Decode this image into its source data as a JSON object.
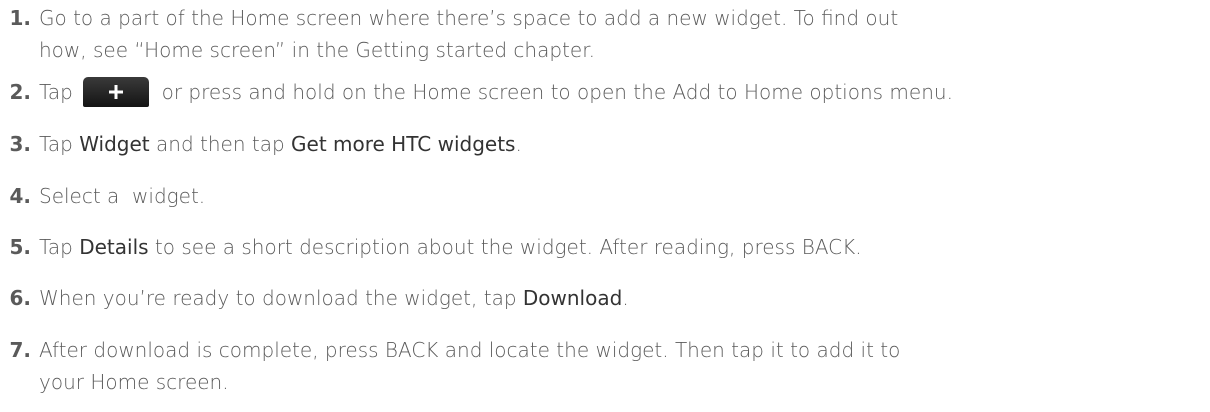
{
  "steps": [
    {
      "number": "1.",
      "lines": [
        "Go to a part of the Home screen where there’s space to add a new widget. To find out",
        "how, see “Home screen” in the Getting started chapter."
      ]
    },
    {
      "number": "2.",
      "before": "Tap",
      "icon": "plus-icon",
      "after": "or press and hold on the Home screen to open the Add to Home options menu."
    },
    {
      "number": "3.",
      "t1": "Tap ",
      "h1": "Widget",
      "t2": " and then tap ",
      "h2": "Get more HTC widgets",
      "t3": "."
    },
    {
      "number": "4.",
      "text": "Select a  widget."
    },
    {
      "number": "5.",
      "t1": "Tap ",
      "h1": "Details",
      "t2": " to see a short description about the widget. After reading, press BACK."
    },
    {
      "number": "6.",
      "t1": "When you’re ready to download the widget, tap ",
      "h1": "Download",
      "t2": "."
    },
    {
      "number": "7.",
      "lines": [
        "After download is complete, press BACK and locate the widget. Then tap it to add it to",
        "your Home screen."
      ]
    }
  ]
}
